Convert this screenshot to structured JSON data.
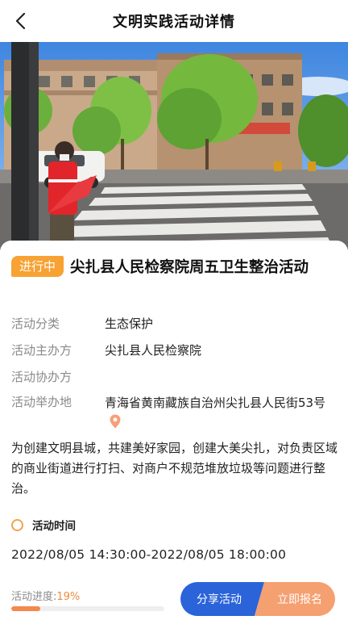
{
  "nav": {
    "title": "文明实践活动详情"
  },
  "activity": {
    "status": "进行中",
    "title": "尖扎县人民检察院周五卫生整治活动",
    "fields": [
      {
        "label": "活动分类",
        "value": "生态保护"
      },
      {
        "label": "活动主办方",
        "value": "尖扎县人民检察院"
      },
      {
        "label": "活动协办方",
        "value": ""
      },
      {
        "label": "活动举办地",
        "value": "青海省黄南藏族自治州尖扎县人民街53号"
      }
    ],
    "description": "为创建文明县城，共建美好家园，创建大美尖扎，对负责区域的商业街道进行打扫、对商户不规范堆放垃圾等问题进行整治。",
    "time_label": "活动时间",
    "time_value": "2022/08/05 14:30:00-2022/08/05 18:00:00"
  },
  "footer": {
    "progress_label": "活动进度:",
    "progress_text": "19%",
    "progress_fraction": 0.19,
    "share_label": "分享活动",
    "signup_label": "立即报名"
  },
  "colors": {
    "badge": "#f7a233",
    "share_button": "#2b63d9",
    "signup_button": "#f5a070",
    "progress_fill": "#f3894c"
  },
  "icons": {
    "back": "chevron-left-icon",
    "location": "location-pin-icon",
    "time": "ring-icon"
  }
}
